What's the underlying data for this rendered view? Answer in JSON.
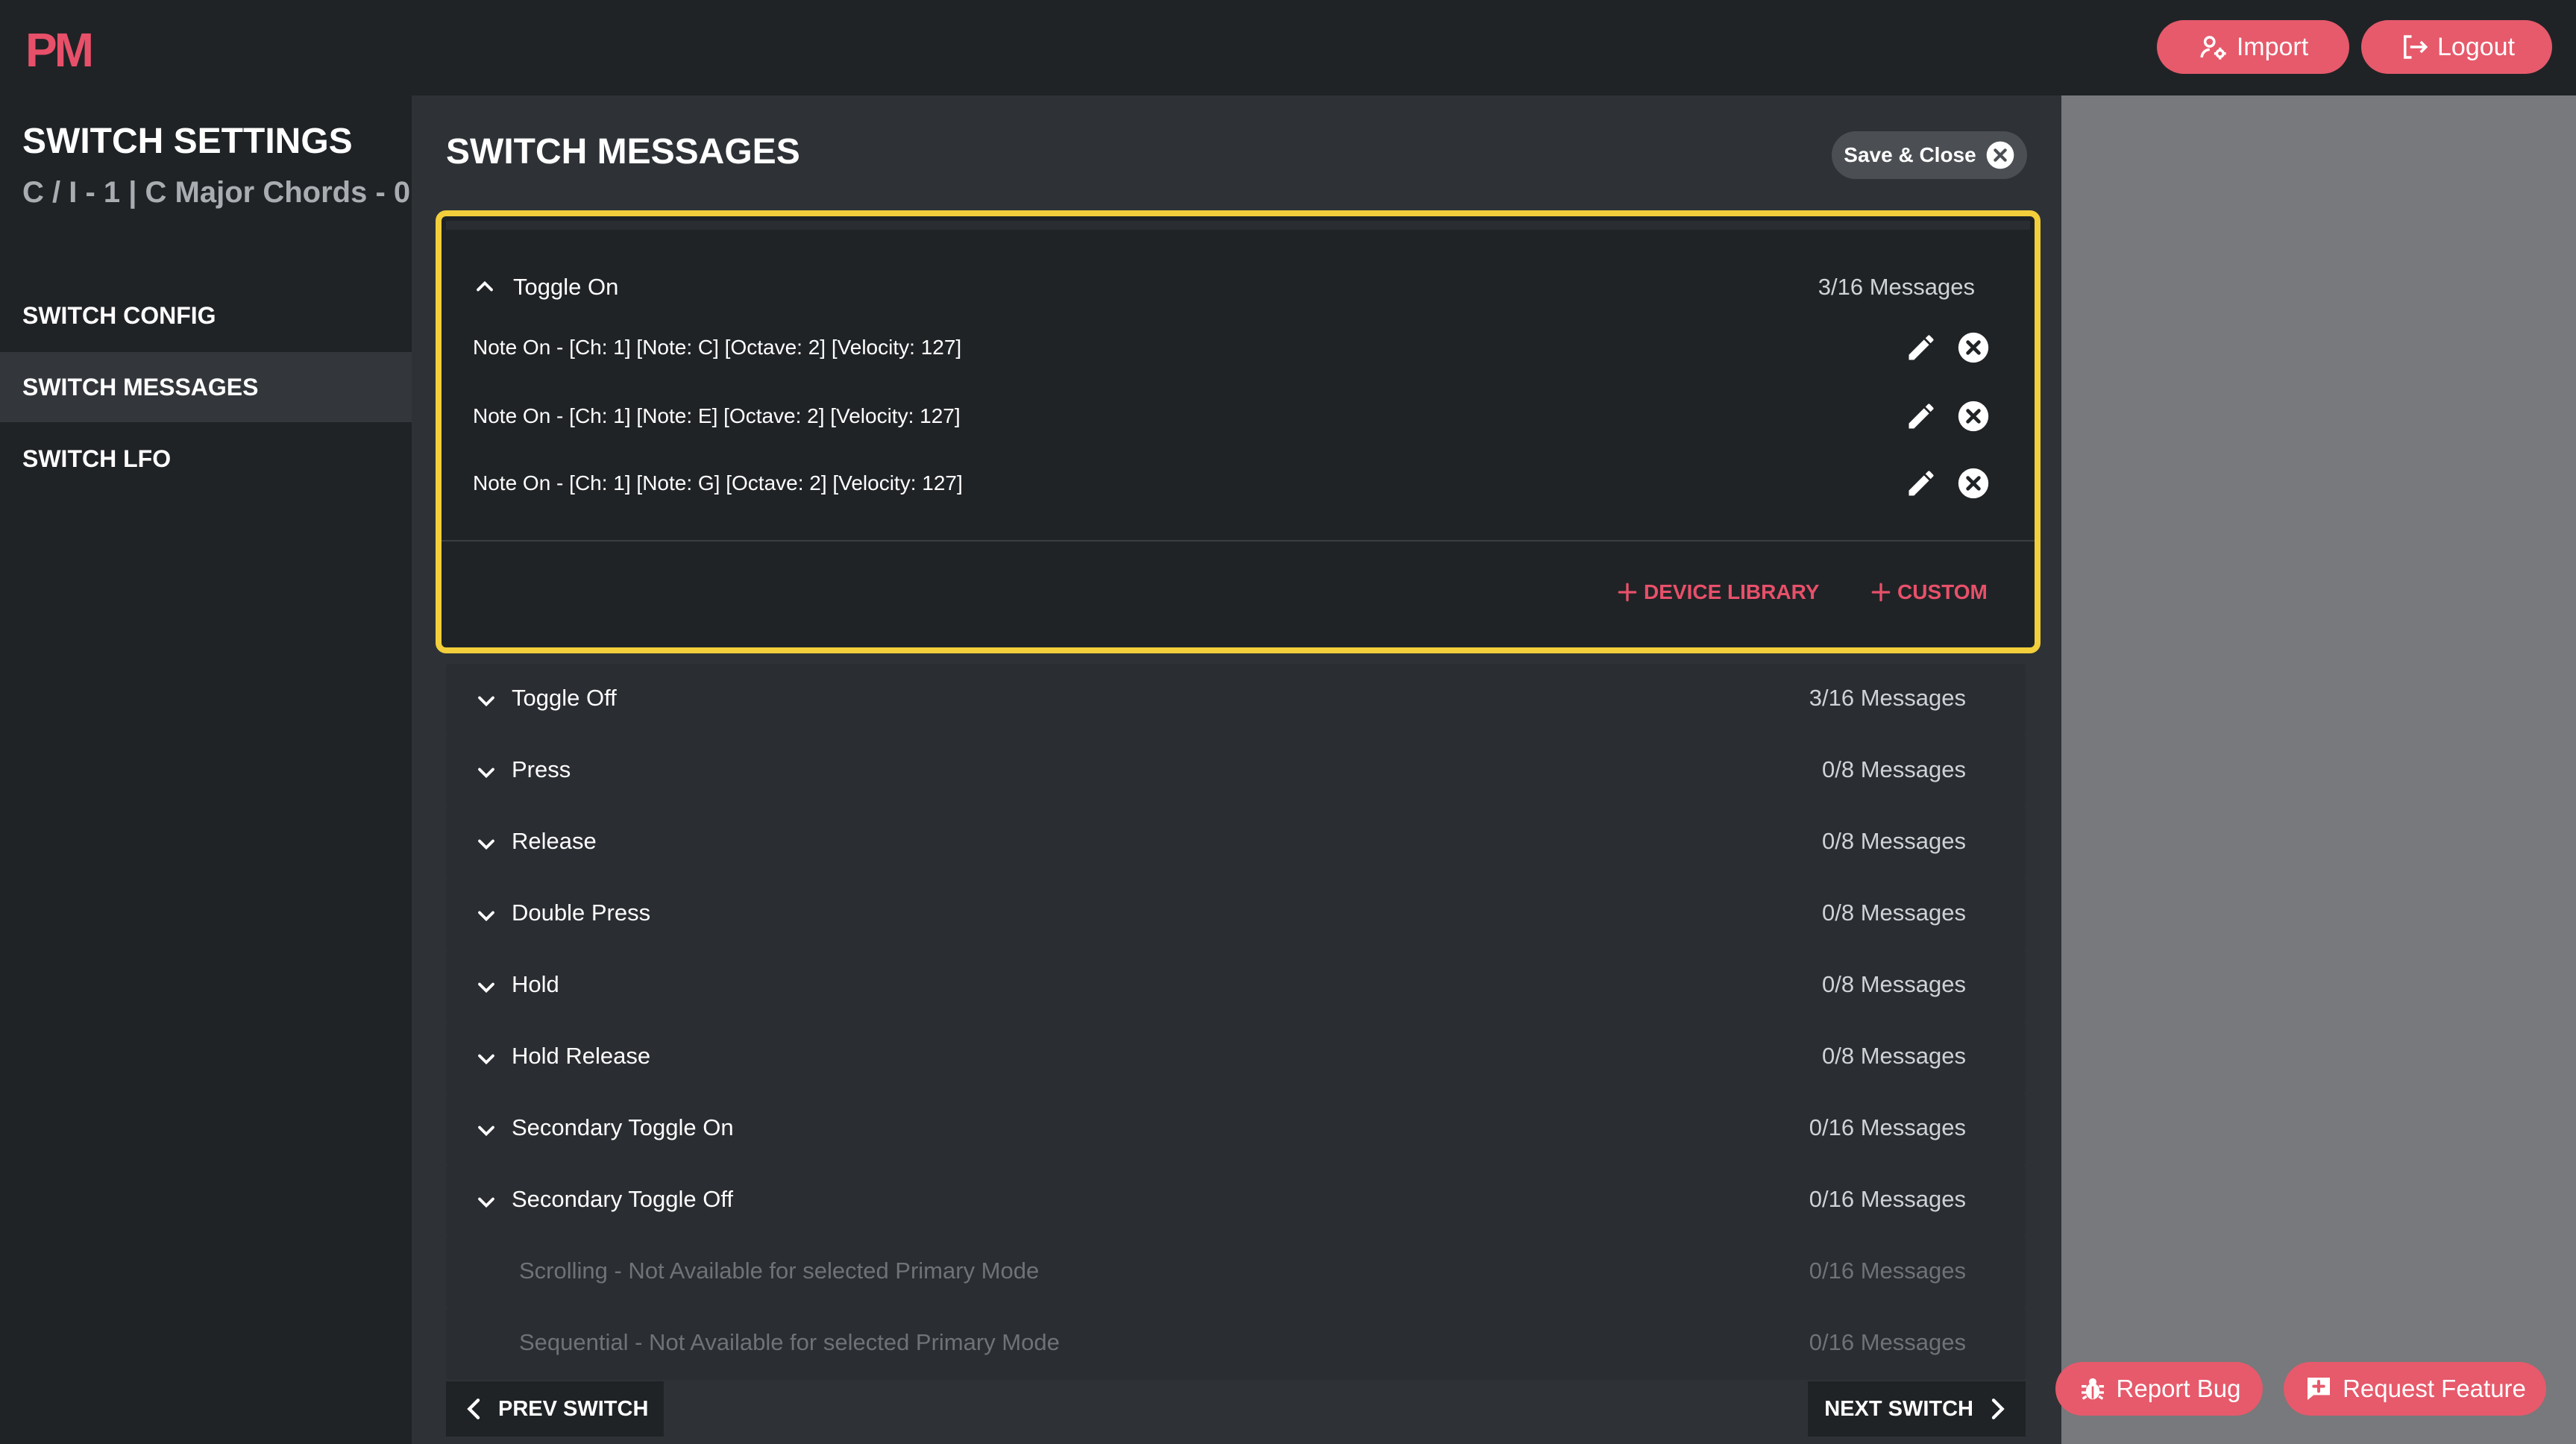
{
  "header": {
    "logo": "PM",
    "import_label": "Import",
    "logout_label": "Logout",
    "accent_color": "#e65a6b"
  },
  "sidebar": {
    "title": "SWITCH SETTINGS",
    "subtitle": "C / I - 1 | C Major Chords - 0",
    "items": [
      {
        "label": "SWITCH CONFIG",
        "active": false
      },
      {
        "label": "SWITCH MESSAGES",
        "active": true
      },
      {
        "label": "SWITCH LFO",
        "active": false
      }
    ]
  },
  "main": {
    "title": "SWITCH MESSAGES",
    "save_close_label": "Save & Close",
    "expanded_section": {
      "label": "Toggle On",
      "count": "3/16 Messages",
      "messages": [
        "Note On - [Ch: 1] [Note: C] [Octave: 2] [Velocity: 127]",
        "Note On - [Ch: 1] [Note: E] [Octave: 2] [Velocity: 127]",
        "Note On - [Ch: 1] [Note: G] [Octave: 2] [Velocity: 127]"
      ],
      "device_library_label": "DEVICE LIBRARY",
      "custom_label": "CUSTOM"
    },
    "sections": [
      {
        "label": "Toggle Off",
        "count": "3/16 Messages"
      },
      {
        "label": "Press",
        "count": "0/8 Messages"
      },
      {
        "label": "Release",
        "count": "0/8 Messages"
      },
      {
        "label": "Double Press",
        "count": "0/8 Messages"
      },
      {
        "label": "Hold",
        "count": "0/8 Messages"
      },
      {
        "label": "Hold Release",
        "count": "0/8 Messages"
      },
      {
        "label": "Secondary Toggle On",
        "count": "0/16 Messages"
      },
      {
        "label": "Secondary Toggle Off",
        "count": "0/16 Messages"
      },
      {
        "label": "Scrolling - Not Available for selected Primary Mode",
        "count": "0/16 Messages"
      },
      {
        "label": "Sequential - Not Available for selected Primary Mode",
        "count": "0/16 Messages"
      }
    ],
    "prev_label": "PREV SWITCH",
    "next_label": "NEXT SWITCH"
  },
  "footer": {
    "report_bug_label": "Report Bug",
    "request_feature_label": "Request Feature"
  }
}
